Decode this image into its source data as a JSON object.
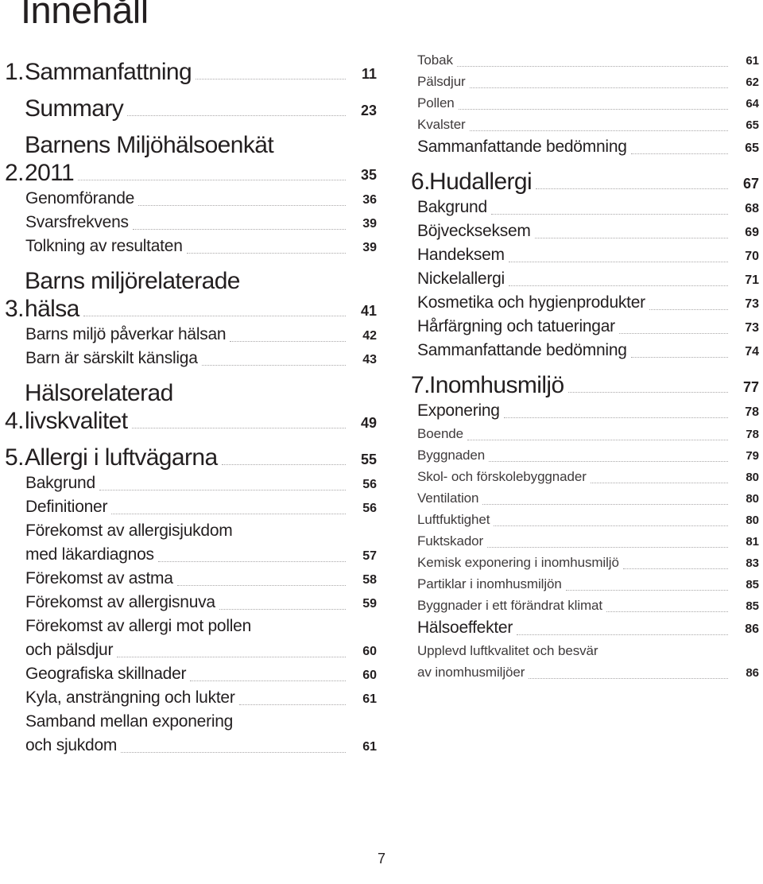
{
  "document": {
    "title": "Innehåll",
    "folio": "7"
  },
  "left_column": [
    {
      "level": 1,
      "chapter": "1.",
      "text": "Sammanfattning",
      "page": "11",
      "lines": [
        "Sammanfattning"
      ]
    },
    {
      "level": 1,
      "chapter": "",
      "text": "Summary",
      "page": "23",
      "lines": [
        "Summary"
      ]
    },
    {
      "level": 1,
      "chapter": "2.",
      "text": "Barnens Miljöhälsoenkät 2011",
      "page": "35",
      "lines": [
        "Barnens Miljöhälsoenkät",
        "2011"
      ]
    },
    {
      "level": 2,
      "text": "Genomförande",
      "page": "36",
      "lines": [
        "Genomförande"
      ]
    },
    {
      "level": 2,
      "text": "Svarsfrekvens",
      "page": "39",
      "lines": [
        "Svarsfrekvens"
      ]
    },
    {
      "level": 2,
      "text": "Tolkning av resultaten",
      "page": "39",
      "lines": [
        "Tolkning av resultaten"
      ]
    },
    {
      "level": 1,
      "chapter": "3.",
      "text": "Barns miljörelaterade hälsa",
      "page": "41",
      "lines": [
        "Barns miljörelaterade",
        "hälsa"
      ]
    },
    {
      "level": 2,
      "text": "Barns miljö påverkar hälsan",
      "page": "42",
      "lines": [
        "Barns miljö påverkar hälsan"
      ]
    },
    {
      "level": 2,
      "text": "Barn är särskilt känsliga",
      "page": "43",
      "lines": [
        "Barn är särskilt känsliga"
      ]
    },
    {
      "level": 1,
      "chapter": "4.",
      "text": "Hälsorelaterad livskvalitet",
      "page": "49",
      "lines": [
        "Hälsorelaterad",
        "livskvalitet"
      ]
    },
    {
      "level": 1,
      "chapter": "5.",
      "text": "Allergi i luftvägarna",
      "page": "55",
      "lines": [
        "Allergi i luftvägarna"
      ]
    },
    {
      "level": 2,
      "text": "Bakgrund",
      "page": "56",
      "lines": [
        "Bakgrund"
      ]
    },
    {
      "level": 2,
      "text": "Definitioner",
      "page": "56",
      "lines": [
        "Definitioner"
      ]
    },
    {
      "level": 2,
      "text": "Förekomst av allergisjukdom med läkardiagnos",
      "page": "57",
      "lines": [
        "Förekomst av allergisjukdom",
        "med läkardiagnos"
      ]
    },
    {
      "level": 2,
      "text": "Förekomst av astma",
      "page": "58",
      "lines": [
        "Förekomst av astma"
      ]
    },
    {
      "level": 2,
      "text": "Förekomst av allergisnuva",
      "page": "59",
      "lines": [
        "Förekomst av allergisnuva"
      ]
    },
    {
      "level": 2,
      "text": "Förekomst av allergi mot pollen och pälsdjur",
      "page": "60",
      "lines": [
        "Förekomst av allergi mot pollen",
        "och pälsdjur"
      ]
    },
    {
      "level": 2,
      "text": "Geografiska skillnader",
      "page": "60",
      "lines": [
        "Geografiska skillnader"
      ]
    },
    {
      "level": 2,
      "text": "Kyla, ansträngning och lukter",
      "page": "61",
      "lines": [
        "Kyla, ansträngning och lukter"
      ]
    },
    {
      "level": 2,
      "text": "Samband mellan exponering och sjukdom",
      "page": "61",
      "lines": [
        "Samband mellan exponering",
        "och sjukdom"
      ]
    }
  ],
  "right_column": [
    {
      "level": 3,
      "text": "Tobak",
      "page": "61",
      "lines": [
        "Tobak"
      ]
    },
    {
      "level": 3,
      "text": "Pälsdjur",
      "page": "62",
      "lines": [
        "Pälsdjur"
      ]
    },
    {
      "level": 3,
      "text": "Pollen",
      "page": "64",
      "lines": [
        "Pollen"
      ]
    },
    {
      "level": 3,
      "text": "Kvalster",
      "page": "65",
      "lines": [
        "Kvalster"
      ]
    },
    {
      "level": 2,
      "text": "Sammanfattande bedömning",
      "page": "65",
      "lines": [
        "Sammanfattande bedömning"
      ]
    },
    {
      "level": 1,
      "chapter": "6.",
      "text": "Hudallergi",
      "page": "67",
      "lines": [
        "Hudallergi"
      ]
    },
    {
      "level": 2,
      "text": "Bakgrund",
      "page": "68",
      "lines": [
        "Bakgrund"
      ]
    },
    {
      "level": 2,
      "text": "Böjveckseksem",
      "page": "69",
      "lines": [
        "Böjveckseksem"
      ]
    },
    {
      "level": 2,
      "text": "Handeksem",
      "page": "70",
      "lines": [
        "Handeksem"
      ]
    },
    {
      "level": 2,
      "text": "Nickelallergi",
      "page": "71",
      "lines": [
        "Nickelallergi"
      ]
    },
    {
      "level": 2,
      "text": "Kosmetika och hygienprodukter",
      "page": "73",
      "lines": [
        "Kosmetika och hygienprodukter"
      ]
    },
    {
      "level": 2,
      "text": "Hårfärgning och tatueringar",
      "page": "73",
      "lines": [
        "Hårfärgning och tatueringar"
      ]
    },
    {
      "level": 2,
      "text": "Sammanfattande bedömning",
      "page": "74",
      "lines": [
        "Sammanfattande bedömning"
      ]
    },
    {
      "level": 1,
      "chapter": "7.",
      "text": "Inomhusmiljö",
      "page": "77",
      "lines": [
        "Inomhusmiljö"
      ]
    },
    {
      "level": 2,
      "text": "Exponering",
      "page": "78",
      "lines": [
        "Exponering"
      ]
    },
    {
      "level": 3,
      "text": "Boende",
      "page": "78",
      "lines": [
        "Boende"
      ]
    },
    {
      "level": 3,
      "text": "Byggnaden",
      "page": "79",
      "lines": [
        "Byggnaden"
      ]
    },
    {
      "level": 3,
      "text": "Skol- och förskolebyggnader",
      "page": "80",
      "lines": [
        "Skol- och förskolebyggnader"
      ]
    },
    {
      "level": 3,
      "text": "Ventilation",
      "page": "80",
      "lines": [
        "Ventilation"
      ]
    },
    {
      "level": 3,
      "text": "Luftfuktighet",
      "page": "80",
      "lines": [
        "Luftfuktighet"
      ]
    },
    {
      "level": 3,
      "text": "Fuktskador",
      "page": "81",
      "lines": [
        "Fuktskador"
      ]
    },
    {
      "level": 3,
      "text": "Kemisk exponering i inomhusmiljö",
      "page": "83",
      "lines": [
        "Kemisk exponering i inomhusmiljö"
      ]
    },
    {
      "level": 3,
      "text": "Partiklar i inomhusmiljön",
      "page": "85",
      "lines": [
        "Partiklar i inomhusmiljön"
      ]
    },
    {
      "level": 3,
      "text": "Byggnader i ett förändrat klimat",
      "page": "85",
      "lines": [
        "Byggnader i ett förändrat klimat"
      ]
    },
    {
      "level": 2,
      "text": "Hälsoeffekter",
      "page": "86",
      "lines": [
        "Hälsoeffekter"
      ]
    },
    {
      "level": 3,
      "text": "Upplevd luftkvalitet och besvär av inomhusmiljöer",
      "page": "86",
      "lines": [
        "Upplevd luftkvalitet och besvär",
        "av inomhusmiljöer"
      ]
    }
  ]
}
